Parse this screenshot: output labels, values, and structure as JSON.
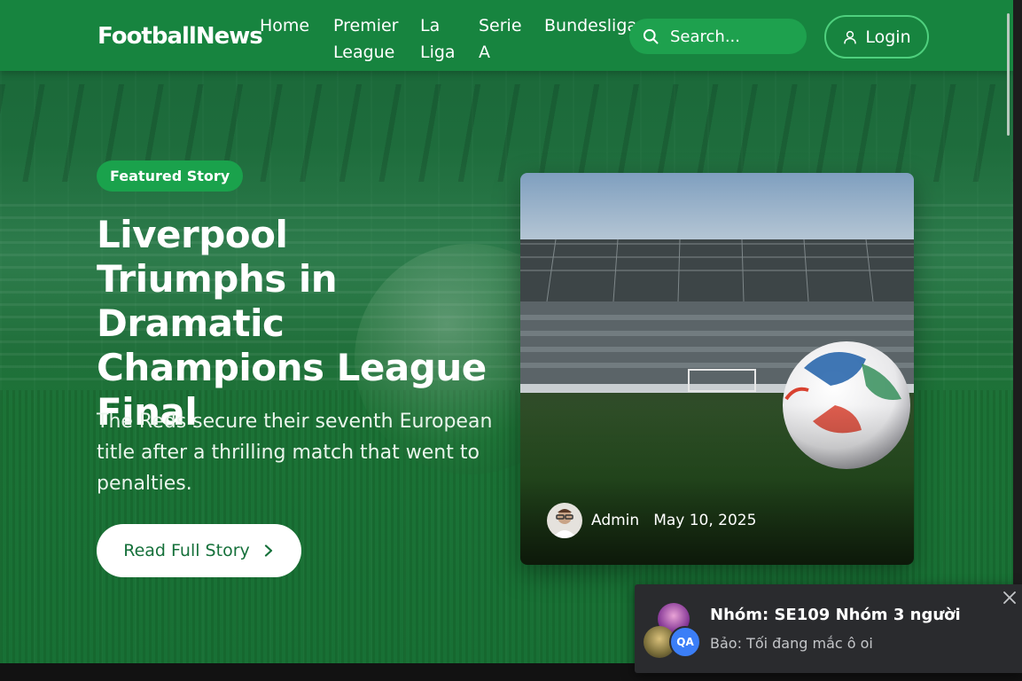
{
  "header": {
    "brand": "FootballNews",
    "nav": [
      {
        "label": "Home"
      },
      {
        "label": "Premier\nLeague"
      },
      {
        "label": "La\nLiga"
      },
      {
        "label": "Serie\nA"
      },
      {
        "label": "Bundesliga"
      }
    ],
    "search": {
      "placeholder": "Search...",
      "icon": "search-icon"
    },
    "login_label": "Login",
    "login_icon": "user-icon"
  },
  "hero": {
    "badge": "Featured Story",
    "title": "Liverpool Triumphs in Dramatic Champions League Final",
    "subtitle": "The Reds secure their seventh European title after a thrilling match that went to penalties.",
    "cta_label": "Read Full Story",
    "cta_icon": "chevron-right-icon",
    "card": {
      "author": "Admin",
      "date": "May 10, 2025"
    }
  },
  "notification": {
    "title": "Nhóm: SE109 Nhóm 3 người",
    "message": "Bảo: Tối đang mắc ô oi",
    "avatar_initials": "QA",
    "close_icon": "close-icon"
  },
  "colors": {
    "header_bg": "#17843f",
    "accent_green": "#1aa24c",
    "button_text": "#15703a",
    "toast_bg": "#2a2b2e"
  }
}
